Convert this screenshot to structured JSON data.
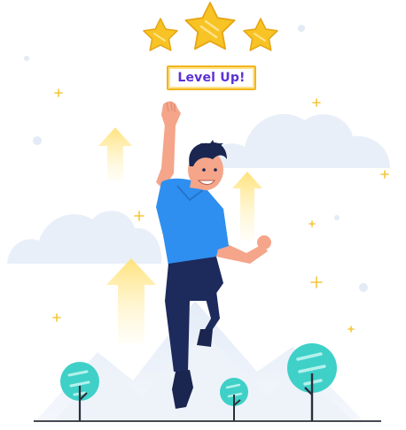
{
  "badge": {
    "text": "Level Up!"
  },
  "rating": {
    "filled_stars": 3,
    "total_stars": 3
  },
  "colors": {
    "star_gold": "#f7c325",
    "star_shadow": "#e6a514",
    "badge_border": "#f2b51e",
    "badge_text": "#5b31d6",
    "shirt_blue": "#2f8ff0",
    "pants_navy": "#1d2a5c",
    "skin": "#f4a58a",
    "hair": "#1a2550",
    "tree_teal": "#3fd0c8",
    "sky_cloud": "#e6eef9",
    "arrow_yellow": "#ffe789"
  }
}
